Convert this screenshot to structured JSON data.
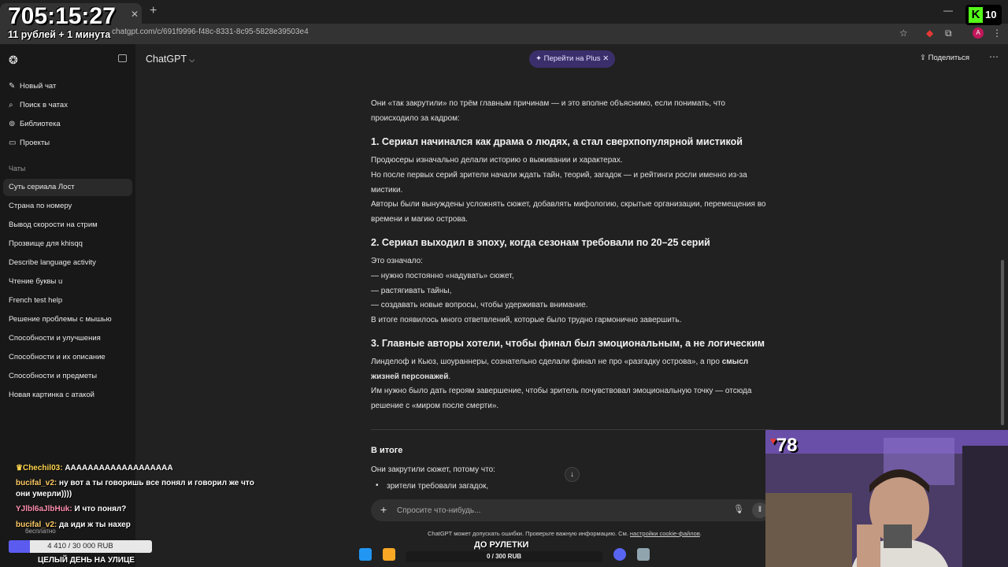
{
  "browser": {
    "url": "chatgpt.com/c/691f9996-f48c-8331-8c95-5828e39503e4"
  },
  "sidebar": {
    "items": [
      {
        "label": "Новый чат",
        "icon": "edit-icon"
      },
      {
        "label": "Поиск в чатах",
        "icon": "search-icon"
      },
      {
        "label": "Библиотека",
        "icon": "library-icon"
      },
      {
        "label": "Проекты",
        "icon": "folder-icon"
      }
    ],
    "chats_heading": "Чаты",
    "chats": [
      "Суть сериала Лост",
      "Страна по номеру",
      "Вывод скорости на стрим",
      "Прозвище для khisqq",
      "Describe language activity",
      "Чтение буквы u",
      "French test help",
      "Решение проблемы с мышью",
      "Способности и улучшения",
      "Способности и их описание",
      "Способности и предметы",
      "Новая картинка с атакой"
    ]
  },
  "header": {
    "title": "ChatGPT",
    "plus_label": "Перейти на Plus",
    "share_label": "Поделиться"
  },
  "article": {
    "intro": "Они «так закрутили» по трём главным причинам — и это вполне объяснимо, если понимать, что происходило за кадром:",
    "h1": "1. Сериал начинался как драма о людях, а стал сверхпопулярной мистикой",
    "s1_l1": "Продюсеры изначально делали историю о выживании и характерах.",
    "s1_l2": "Но после первых серий зрители начали ждать тайн, теорий, загадок — и рейтинги росли именно из-за мистики.",
    "s1_l3": "Авторы были вынуждены усложнять сюжет, добавлять мифологию, скрытые организации, перемещения во времени и магию острова.",
    "h2": "2. Сериал выходил в эпоху, когда сезонам требовали по 20–25 серий",
    "s2_l1": "Это означало:",
    "s2_l2": "— нужно постоянно «надувать» сюжет,",
    "s2_l3": "— растягивать тайны,",
    "s2_l4": "— создавать новые вопросы, чтобы удерживать внимание.",
    "s2_l5": "В итоге появилось много ответвлений, которые было трудно гармонично завершить.",
    "h3": "3. Главные авторы хотели, чтобы финал был эмоциональным, а не логическим",
    "s3_l1a": "Линделоф и Кьюз, шоураннеры, сознательно сделали финал не про «разгадку острова», а про ",
    "s3_l1b": "смысл жизней персонажей",
    "s3_l1c": ".",
    "s3_l2": "Им нужно было дать героям завершение, чтобы зритель почувствовал эмоциональную точку — отсюда решение с «миром после смерти».",
    "summary_title": "В итоге",
    "summary_intro": "Они закрутили сюжет, потому что:",
    "summary_bullet": "зрители требовали загадок,"
  },
  "composer": {
    "placeholder": "Спросите что-нибудь...",
    "disclaimer_text": "ChatGPT может допускать ошибки. Проверьте важную информацию. См. ",
    "disclaimer_link": "настройки cookie-файлов",
    "disclaimer_end": "."
  },
  "stream": {
    "timer": "705:15:27",
    "timer_sub": "11 рублей + 1 минута",
    "kick_count": "10",
    "viewer_count": "78",
    "chat": [
      {
        "user": "Chechil03:",
        "msg": "ААААААААААААААААААА"
      },
      {
        "user": "bucifal_v2:",
        "msg": "ну вот а ты говоришь все понял и говорил же что они умерли))))"
      },
      {
        "user": "YJlbl6aJlbHuk:",
        "msg": "И что понял?"
      },
      {
        "user": "bucifal_v2:",
        "msg": "да иди ж ты нахер"
      }
    ],
    "free_label": "бесплатно",
    "donate_text": "4 410 / 30 000 RUB",
    "donate_progress": 0.147,
    "day_label": "ЦЕЛЫЙ ДЕНЬ НА УЛИЦЕ",
    "roulette_title": "ДО РУЛЕТКИ",
    "roulette_text": "0 / 300 RUB"
  },
  "colors": {
    "page_bg": "#212121",
    "sidebar_bg": "#181818",
    "plus_pill": "#3b2f6b",
    "kick_green": "#53fc18",
    "donate_fill": "#5b5bf0"
  }
}
